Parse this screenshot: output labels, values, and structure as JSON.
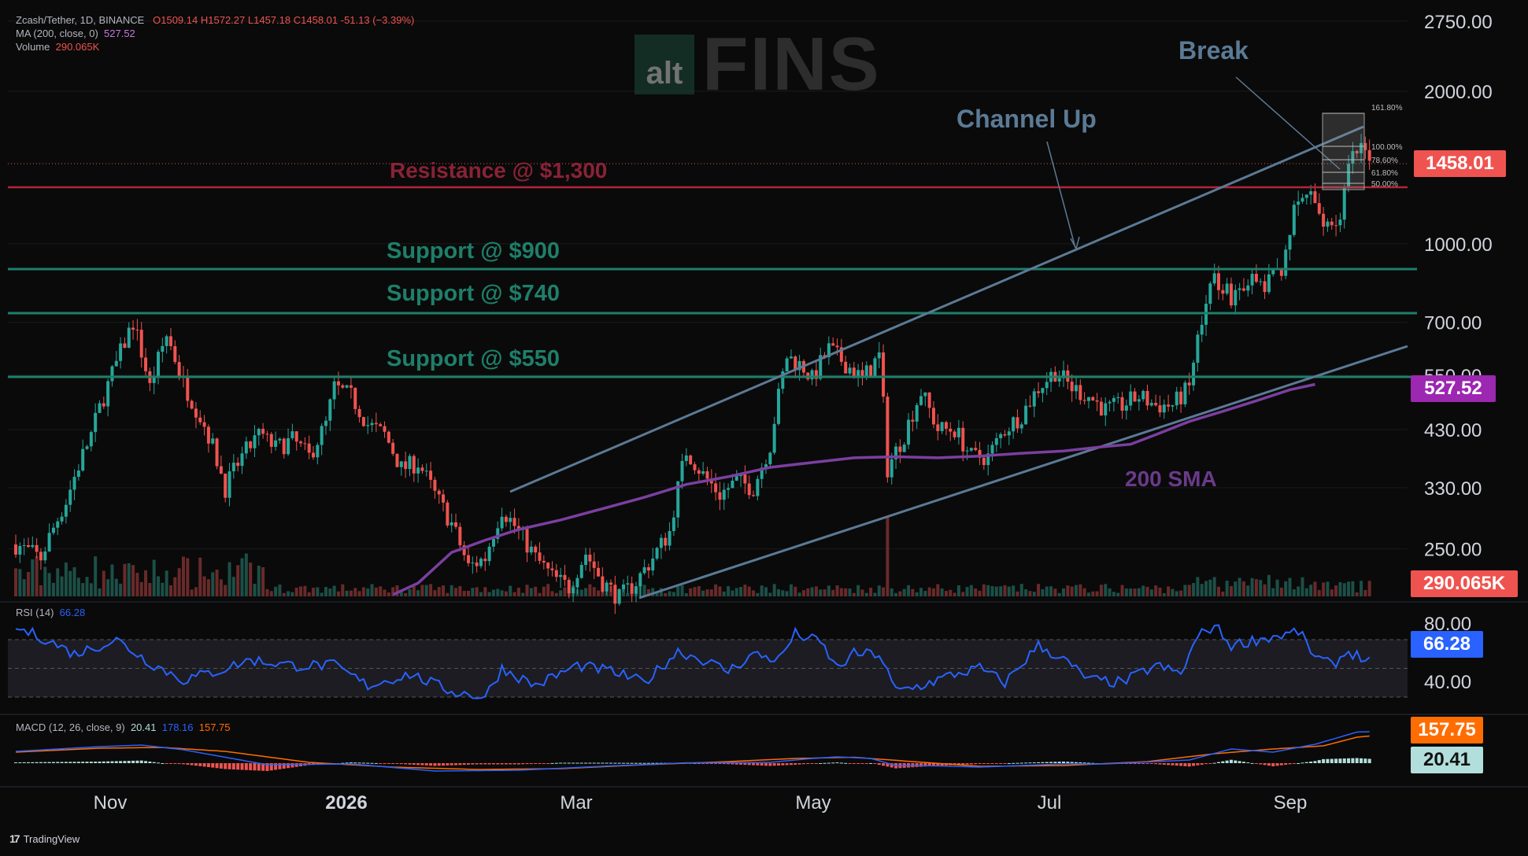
{
  "header": {
    "symbol_line": "Zcash/Tether, 1D, BINANCE",
    "ohlc": {
      "open": "O1509.14",
      "high": "H1572.27",
      "low": "L1457.18",
      "close": "C1458.01",
      "change": "-51.13 (−3.39%)"
    },
    "ma_label": "MA (200, close, 0)",
    "ma_value": "527.52",
    "volume_label": "Volume",
    "volume_value": "290.065K"
  },
  "watermark": {
    "box": "alt",
    "text": "FINS"
  },
  "annotations": {
    "break": "Break",
    "channel_up": "Channel Up",
    "resistance": "Resistance @ $1,300",
    "support_900": "Support @ $900",
    "support_740": "Support @ $740",
    "support_550": "Support @ $550",
    "sma_200": "200 SMA"
  },
  "price_tags": {
    "last": "1458.01",
    "ma": "527.52",
    "volume": "290.065K",
    "rsi": "66.28",
    "macd_signal": "157.75",
    "macd_hist": "20.41"
  },
  "fib_levels": [
    "161.80%",
    "100.00%",
    "78.60%",
    "61.80%",
    "50.00%"
  ],
  "rsi_pane": {
    "title": "RSI (14)",
    "value": "66.28",
    "ticks": [
      "80.00",
      "40.00"
    ]
  },
  "macd_pane": {
    "title": "MACD (12, 26, close, 9)",
    "v1": "20.41",
    "v2": "178.16",
    "v3": "157.75"
  },
  "footer": {
    "brand": "TradingView"
  },
  "colors": {
    "up": "#26a69a",
    "down": "#ef5350",
    "resistance": "#b2243a",
    "support": "#1e7f6a",
    "channel": "#5b7a95",
    "sma": "#7b3fa0",
    "rsi": "#2962ff",
    "macd": "#2962ff",
    "signal": "#ff6d00"
  },
  "chart_data": {
    "type": "candlestick",
    "y_scale": "log",
    "ylim": [
      200,
      2900
    ],
    "y_ticks": [
      "2750.00",
      "2000.00",
      "1000.00",
      "700.00",
      "550.00",
      "430.00",
      "330.00",
      "250.00"
    ],
    "y_tick_values": [
      2750,
      2000,
      1000,
      700,
      550,
      430,
      330,
      250
    ],
    "x_ticks": [
      "Nov",
      "2026",
      "Mar",
      "May",
      "Jul",
      "Sep"
    ],
    "price_path": [
      [
        0,
        255
      ],
      [
        6,
        240
      ],
      [
        12,
        310
      ],
      [
        18,
        420
      ],
      [
        24,
        580
      ],
      [
        28,
        700
      ],
      [
        32,
        520
      ],
      [
        36,
        660
      ],
      [
        40,
        530
      ],
      [
        46,
        420
      ],
      [
        50,
        330
      ],
      [
        54,
        380
      ],
      [
        58,
        420
      ],
      [
        62,
        395
      ],
      [
        66,
        410
      ],
      [
        70,
        380
      ],
      [
        74,
        440
      ],
      [
        76,
        520
      ],
      [
        80,
        500
      ],
      [
        84,
        440
      ],
      [
        88,
        420
      ],
      [
        92,
        360
      ],
      [
        96,
        370
      ],
      [
        100,
        320
      ],
      [
        104,
        280
      ],
      [
        108,
        230
      ],
      [
        112,
        240
      ],
      [
        116,
        300
      ],
      [
        120,
        270
      ],
      [
        124,
        240
      ],
      [
        128,
        220
      ],
      [
        132,
        210
      ],
      [
        136,
        245
      ],
      [
        140,
        215
      ],
      [
        144,
        200
      ],
      [
        148,
        215
      ],
      [
        152,
        240
      ],
      [
        156,
        270
      ],
      [
        160,
        390
      ],
      [
        164,
        350
      ],
      [
        168,
        320
      ],
      [
        172,
        340
      ],
      [
        176,
        330
      ],
      [
        180,
        400
      ],
      [
        184,
        600
      ],
      [
        188,
        570
      ],
      [
        190,
        540
      ],
      [
        194,
        620
      ],
      [
        198,
        580
      ],
      [
        202,
        540
      ],
      [
        206,
        600
      ],
      [
        208,
        360
      ],
      [
        212,
        420
      ],
      [
        216,
        510
      ],
      [
        220,
        430
      ],
      [
        224,
        430
      ],
      [
        228,
        380
      ],
      [
        232,
        380
      ],
      [
        236,
        430
      ],
      [
        240,
        460
      ],
      [
        244,
        520
      ],
      [
        248,
        560
      ],
      [
        252,
        520
      ],
      [
        256,
        500
      ],
      [
        260,
        470
      ],
      [
        264,
        480
      ],
      [
        268,
        500
      ],
      [
        272,
        480
      ],
      [
        276,
        480
      ],
      [
        280,
        520
      ],
      [
        283,
        720
      ],
      [
        286,
        860
      ],
      [
        290,
        790
      ],
      [
        294,
        850
      ],
      [
        298,
        820
      ],
      [
        302,
        900
      ],
      [
        305,
        1150
      ],
      [
        308,
        1260
      ],
      [
        312,
        1110
      ],
      [
        316,
        1110
      ],
      [
        318,
        1410
      ],
      [
        320,
        1520
      ],
      [
        322,
        1510
      ],
      [
        323,
        1458
      ]
    ],
    "sma200_path": [
      [
        90,
        203
      ],
      [
        96,
        214
      ],
      [
        104,
        246
      ],
      [
        112,
        260
      ],
      [
        120,
        273
      ],
      [
        130,
        285
      ],
      [
        140,
        300
      ],
      [
        150,
        316
      ],
      [
        160,
        335
      ],
      [
        170,
        347
      ],
      [
        180,
        362
      ],
      [
        190,
        370
      ],
      [
        200,
        378
      ],
      [
        210,
        380
      ],
      [
        220,
        378
      ],
      [
        230,
        381
      ],
      [
        240,
        386
      ],
      [
        250,
        390
      ],
      [
        260,
        398
      ],
      [
        266,
        402
      ],
      [
        272,
        420
      ],
      [
        280,
        446
      ],
      [
        288,
        467
      ],
      [
        296,
        490
      ],
      [
        304,
        515
      ],
      [
        310,
        528
      ]
    ],
    "rsi_path": [
      [
        0,
        88
      ],
      [
        6,
        82
      ],
      [
        14,
        70
      ],
      [
        24,
        80
      ],
      [
        32,
        64
      ],
      [
        40,
        52
      ],
      [
        48,
        58
      ],
      [
        56,
        66
      ],
      [
        66,
        62
      ],
      [
        76,
        62
      ],
      [
        84,
        48
      ],
      [
        94,
        56
      ],
      [
        104,
        44
      ],
      [
        112,
        40
      ],
      [
        116,
        60
      ],
      [
        124,
        48
      ],
      [
        134,
        62
      ],
      [
        142,
        58
      ],
      [
        150,
        50
      ],
      [
        158,
        72
      ],
      [
        164,
        66
      ],
      [
        170,
        58
      ],
      [
        176,
        70
      ],
      [
        182,
        66
      ],
      [
        186,
        84
      ],
      [
        192,
        78
      ],
      [
        196,
        60
      ],
      [
        200,
        70
      ],
      [
        206,
        70
      ],
      [
        210,
        44
      ],
      [
        216,
        48
      ],
      [
        224,
        56
      ],
      [
        230,
        60
      ],
      [
        236,
        50
      ],
      [
        244,
        76
      ],
      [
        250,
        66
      ],
      [
        256,
        52
      ],
      [
        264,
        50
      ],
      [
        272,
        62
      ],
      [
        278,
        56
      ],
      [
        282,
        82
      ],
      [
        286,
        90
      ],
      [
        290,
        76
      ],
      [
        296,
        80
      ],
      [
        304,
        84
      ],
      [
        306,
        86
      ],
      [
        310,
        68
      ],
      [
        314,
        62
      ],
      [
        318,
        72
      ],
      [
        322,
        66
      ]
    ],
    "macd_path": [
      [
        0,
        150
      ],
      [
        20,
        210
      ],
      [
        30,
        230
      ],
      [
        40,
        170
      ],
      [
        60,
        -20
      ],
      [
        80,
        -10
      ],
      [
        100,
        -100
      ],
      [
        120,
        -90
      ],
      [
        140,
        -40
      ],
      [
        160,
        5
      ],
      [
        180,
        10
      ],
      [
        190,
        60
      ],
      [
        196,
        80
      ],
      [
        204,
        60
      ],
      [
        210,
        -30
      ],
      [
        220,
        -35
      ],
      [
        230,
        -50
      ],
      [
        250,
        -10
      ],
      [
        260,
        -10
      ],
      [
        280,
        40
      ],
      [
        290,
        180
      ],
      [
        300,
        140
      ],
      [
        310,
        240
      ],
      [
        320,
        395
      ],
      [
        323,
        400
      ]
    ],
    "signal_path": [
      [
        0,
        140
      ],
      [
        20,
        190
      ],
      [
        35,
        200
      ],
      [
        50,
        150
      ],
      [
        70,
        10
      ],
      [
        90,
        -50
      ],
      [
        110,
        -80
      ],
      [
        130,
        -70
      ],
      [
        150,
        -20
      ],
      [
        170,
        20
      ],
      [
        186,
        60
      ],
      [
        200,
        75
      ],
      [
        214,
        20
      ],
      [
        230,
        -40
      ],
      [
        250,
        -30
      ],
      [
        270,
        20
      ],
      [
        286,
        120
      ],
      [
        300,
        180
      ],
      [
        312,
        220
      ],
      [
        320,
        330
      ],
      [
        323,
        345
      ]
    ]
  }
}
